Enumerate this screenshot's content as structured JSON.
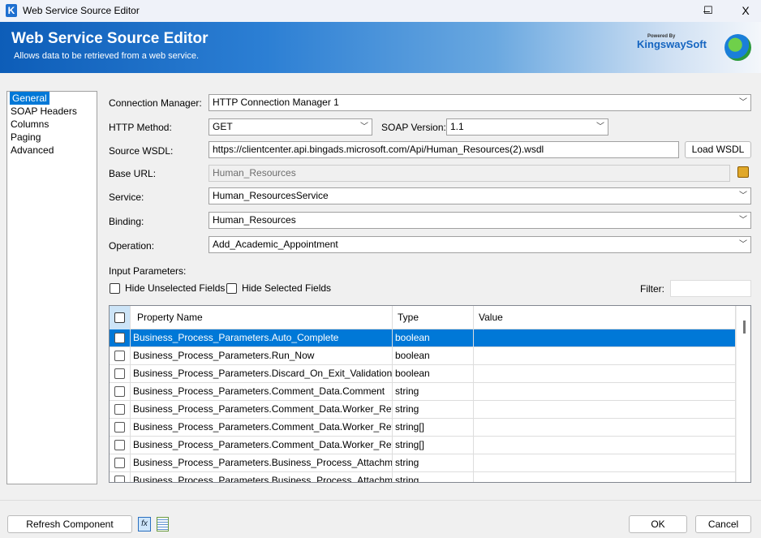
{
  "window": {
    "title": "Web Service Source Editor",
    "minimize": "–",
    "maximize": "☐",
    "close": "X"
  },
  "banner": {
    "title": "Web Service Source Editor",
    "subtitle": "Allows data to be retrieved from a web service.",
    "logo_text": "KingswaySoft",
    "logo_powered": "Powered By"
  },
  "nav": {
    "items": [
      "General",
      "SOAP Headers",
      "Columns",
      "Paging",
      "Advanced"
    ],
    "selected": "General"
  },
  "form": {
    "connection_manager": {
      "label": "Connection Manager:",
      "value": "HTTP Connection Manager 1"
    },
    "http_method": {
      "label": "HTTP Method:",
      "value": "GET"
    },
    "soap_version": {
      "label": "SOAP Version:",
      "value": "1.1"
    },
    "source_wsdl": {
      "label": "Source WSDL:",
      "value": "https://clientcenter.api.bingads.microsoft.com/Api/Human_Resources(2).wsdl"
    },
    "load_wsdl": "Load WSDL",
    "base_url": {
      "label": "Base URL:",
      "value": "Human_Resources"
    },
    "service": {
      "label": "Service:",
      "value": "Human_ResourcesService"
    },
    "binding": {
      "label": "Binding:",
      "value": "Human_Resources"
    },
    "operation": {
      "label": "Operation:",
      "value": "Add_Academic_Appointment"
    },
    "input_parameters": "Input Parameters:",
    "hide_unselected": "Hide Unselected Fields",
    "hide_selected": "Hide Selected Fields",
    "filter_label": "Filter:",
    "filter_value": ""
  },
  "table": {
    "columns": [
      "Property Name",
      "Type",
      "Value"
    ],
    "rows": [
      {
        "name": "Business_Process_Parameters.Auto_Complete",
        "type": "boolean",
        "value": ""
      },
      {
        "name": "Business_Process_Parameters.Run_Now",
        "type": "boolean",
        "value": ""
      },
      {
        "name": "Business_Process_Parameters.Discard_On_Exit_Validation_Error",
        "type": "boolean",
        "value": ""
      },
      {
        "name": "Business_Process_Parameters.Comment_Data.Comment",
        "type": "string",
        "value": ""
      },
      {
        "name": "Business_Process_Parameters.Comment_Data.Worker_Referen...",
        "type": "string",
        "value": ""
      },
      {
        "name": "Business_Process_Parameters.Comment_Data.Worker_Referen...",
        "type": "string[]",
        "value": ""
      },
      {
        "name": "Business_Process_Parameters.Comment_Data.Worker_Referen...",
        "type": "string[]",
        "value": ""
      },
      {
        "name": "Business_Process_Parameters.Business_Process_Attachment_...",
        "type": "string",
        "value": ""
      },
      {
        "name": "Business_Process_Parameters.Business_Process_Attachment...",
        "type": "string",
        "value": ""
      }
    ],
    "selected_row": 0
  },
  "footer": {
    "refresh": "Refresh Component",
    "ok": "OK",
    "cancel": "Cancel"
  },
  "colors": {
    "accent": "#0078d7",
    "banner": "#0d5db8"
  }
}
